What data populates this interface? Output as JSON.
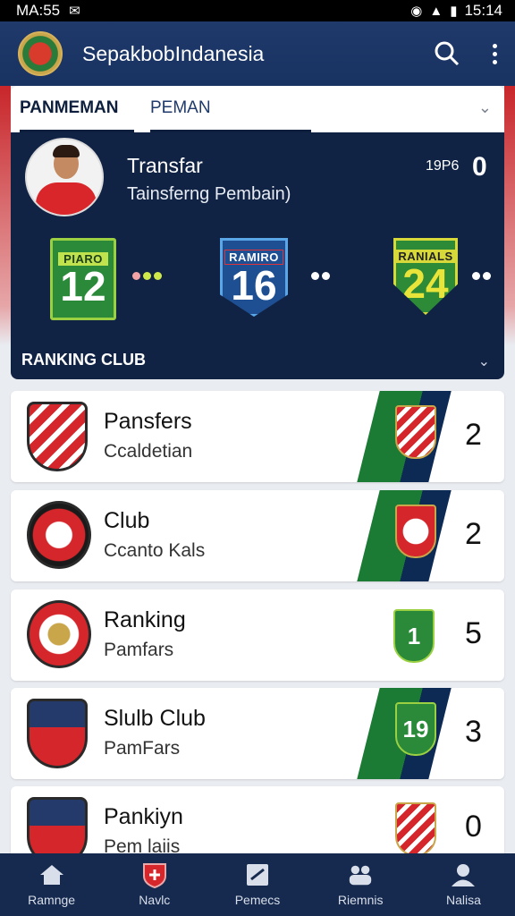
{
  "status_bar": {
    "time_left": "MA:55",
    "time_right": "15:14",
    "mail_icon": "mail-icon",
    "wifi_icon": "wifi-icon",
    "signal_icon": "signal-icon",
    "battery_icon": "battery-icon"
  },
  "app": {
    "title": "SepakbobIndanesia",
    "logo_icon": "club-logo-icon",
    "search_icon": "search-icon",
    "menu_icon": "more-vert-icon"
  },
  "tabs": [
    {
      "label": "PANMEMAN",
      "active": true
    },
    {
      "label": "PEMAN",
      "active": false
    }
  ],
  "transfer": {
    "title": "Transfar",
    "subtitle": "Tainsferng Pembain)",
    "small_value": "19P6",
    "big_value": "0",
    "badges": [
      {
        "top": "PIARO",
        "number": "12"
      },
      {
        "top": "RAMIRO",
        "number": "16"
      },
      {
        "top": "RANIALS",
        "number": "24"
      }
    ],
    "section_label": "RANKING CLUB"
  },
  "clubs": [
    {
      "name": "Pansfers",
      "sub": "Ccaldetian",
      "value": "2"
    },
    {
      "name": "Club",
      "sub": "Ccanto Kals",
      "value": "2"
    },
    {
      "name": "Ranking",
      "sub": "Pamfars",
      "value": "5",
      "mini_number": "1"
    },
    {
      "name": "Slulb Club",
      "sub": "PamFars",
      "value": "3",
      "mini_number": "19"
    },
    {
      "name": "Pankiyn",
      "sub": "Pem laiis",
      "value": "0"
    }
  ],
  "nav": [
    {
      "label": "Ramnge",
      "icon": "home-icon"
    },
    {
      "label": "Navlc",
      "icon": "shield-icon"
    },
    {
      "label": "Pemecs",
      "icon": "news-icon"
    },
    {
      "label": "Riemnis",
      "icon": "players-icon"
    },
    {
      "label": "Nalisa",
      "icon": "profile-icon"
    }
  ],
  "colors": {
    "primary": "#1f3a6b",
    "panel": "#112344",
    "accent_red": "#d4262b",
    "accent_green": "#2a8a3a"
  }
}
